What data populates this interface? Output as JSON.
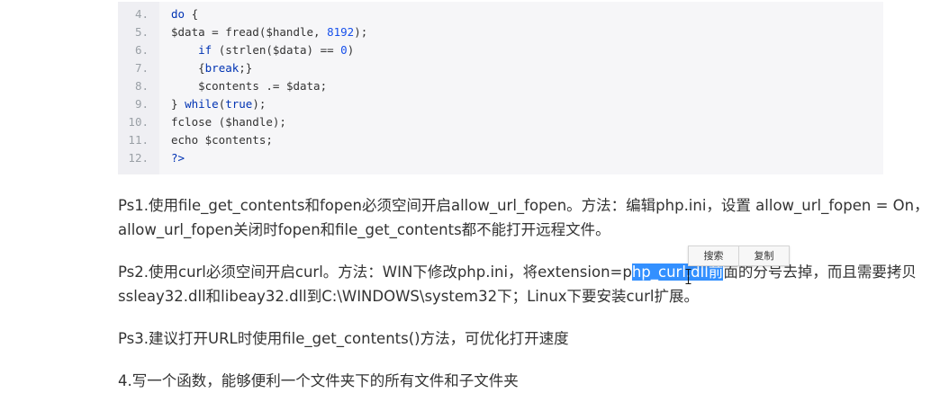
{
  "code": {
    "lines": [
      {
        "num": "4.",
        "indent": "",
        "parts": [
          [
            "kw",
            "do"
          ],
          [
            "",
            " {"
          ]
        ]
      },
      {
        "num": "5.",
        "indent": "",
        "parts": [
          [
            "",
            "$data = fread($handle, "
          ],
          [
            "num",
            "8192"
          ],
          [
            "",
            ");"
          ]
        ]
      },
      {
        "num": "6.",
        "indent": "    ",
        "parts": [
          [
            "kw",
            "if"
          ],
          [
            "",
            " (strlen($data) == "
          ],
          [
            "num",
            "0"
          ],
          [
            "",
            ")"
          ]
        ]
      },
      {
        "num": "7.",
        "indent": "    ",
        "parts": [
          [
            "",
            "{"
          ],
          [
            "kw",
            "break"
          ],
          [
            "",
            ";}"
          ]
        ]
      },
      {
        "num": "8.",
        "indent": "    ",
        "parts": [
          [
            "",
            "$contents .= $data;"
          ]
        ]
      },
      {
        "num": "9.",
        "indent": "",
        "parts": [
          [
            "",
            "} "
          ],
          [
            "kw",
            "while"
          ],
          [
            "",
            "("
          ],
          [
            "kw",
            "true"
          ],
          [
            "",
            ");"
          ]
        ]
      },
      {
        "num": "10.",
        "indent": "",
        "parts": [
          [
            "",
            "fclose ($handle);"
          ]
        ]
      },
      {
        "num": "11.",
        "indent": "",
        "parts": [
          [
            "",
            "echo $contents;"
          ]
        ]
      },
      {
        "num": "12.",
        "indent": "",
        "parts": [
          [
            "kw",
            "?>"
          ]
        ]
      }
    ]
  },
  "paragraphs": {
    "ps1_line1": "Ps1.使用file_get_contents和fopen必须空间开启allow_url_fopen。方法：编辑php.ini，设置 allow_url_fopen = On，",
    "ps1_line2": "allow_url_fopen关闭时fopen和file_get_contents都不能打开远程文件。",
    "ps2_line1_a": "Ps2.使用curl必须空间开启curl。方法：WIN下修改php.ini，将extension=p",
    "ps2_line1_sel": "hp_curl.dll前",
    "ps2_line1_b": "面的分号去掉，而且需要拷贝",
    "ps2_line2": "ssleay32.dll和libeay32.dll到C:\\WINDOWS\\system32下；Linux下要安装curl扩展。",
    "ps3": "Ps3.建议打开URL时使用file_get_contents()方法，可优化打开速度",
    "item4": "4.写一个函数，能够便利一个文件夹下的所有文件和子文件夹"
  },
  "selection_popup": {
    "search_label": "搜索",
    "copy_label": "复制"
  }
}
